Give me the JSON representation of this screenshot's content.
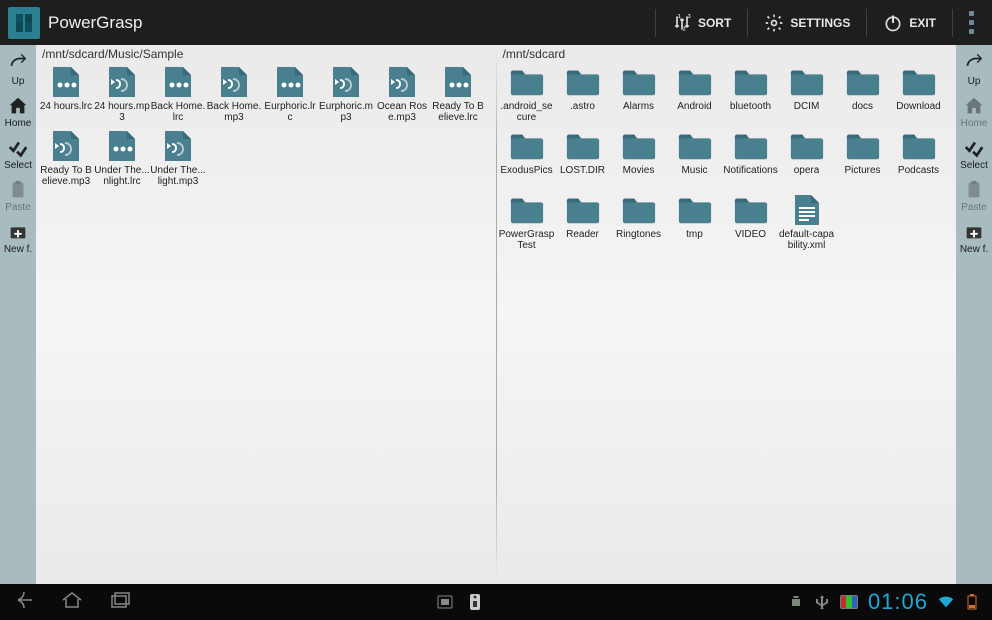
{
  "app": {
    "title": "PowerGrasp"
  },
  "top_actions": {
    "sort": "SORT",
    "settings": "SETTINGS",
    "exit": "EXIT"
  },
  "side": {
    "up": "Up",
    "home": "Home",
    "select": "Select",
    "paste": "Paste",
    "newf": "New f."
  },
  "left_panel": {
    "path": "/mnt/sdcard/Music/Sample",
    "items": [
      {
        "label": "24 hours.lrc",
        "type": "lrc"
      },
      {
        "label": "24 hours.mp3",
        "type": "mp3"
      },
      {
        "label": "Back Home.lrc",
        "type": "lrc"
      },
      {
        "label": "Back Home.mp3",
        "type": "mp3"
      },
      {
        "label": "Eurphoric.lrc",
        "type": "lrc"
      },
      {
        "label": "Eurphoric.mp3",
        "type": "mp3"
      },
      {
        "label": "Ocean Rose.mp3",
        "type": "mp3"
      },
      {
        "label": "Ready To Believe.lrc",
        "type": "lrc"
      },
      {
        "label": "Ready To Believe.mp3",
        "type": "mp3"
      },
      {
        "label": "Under The...nlight.lrc",
        "type": "lrc"
      },
      {
        "label": "Under The...light.mp3",
        "type": "mp3"
      }
    ]
  },
  "right_panel": {
    "path": "/mnt/sdcard",
    "items": [
      {
        "label": ".android_secure",
        "type": "folder"
      },
      {
        "label": ".astro",
        "type": "folder"
      },
      {
        "label": "Alarms",
        "type": "folder"
      },
      {
        "label": "Android",
        "type": "folder"
      },
      {
        "label": "bluetooth",
        "type": "folder"
      },
      {
        "label": "DCIM",
        "type": "folder"
      },
      {
        "label": "docs",
        "type": "folder"
      },
      {
        "label": "Download",
        "type": "folder"
      },
      {
        "label": "ExodusPics",
        "type": "folder"
      },
      {
        "label": "LOST.DIR",
        "type": "folder"
      },
      {
        "label": "Movies",
        "type": "folder"
      },
      {
        "label": "Music",
        "type": "folder"
      },
      {
        "label": "Notifications",
        "type": "folder"
      },
      {
        "label": "opera",
        "type": "folder"
      },
      {
        "label": "Pictures",
        "type": "folder"
      },
      {
        "label": "Podcasts",
        "type": "folder"
      },
      {
        "label": "PowerGraspTest",
        "type": "folder"
      },
      {
        "label": "Reader",
        "type": "folder"
      },
      {
        "label": "Ringtones",
        "type": "folder"
      },
      {
        "label": "tmp",
        "type": "folder"
      },
      {
        "label": "VIDEO",
        "type": "folder"
      },
      {
        "label": "default-capability.xml",
        "type": "doc"
      }
    ]
  },
  "system_bar": {
    "time": "01:06"
  },
  "colors": {
    "accent": "#4a7f8f",
    "folder": "#4a7f8f"
  }
}
